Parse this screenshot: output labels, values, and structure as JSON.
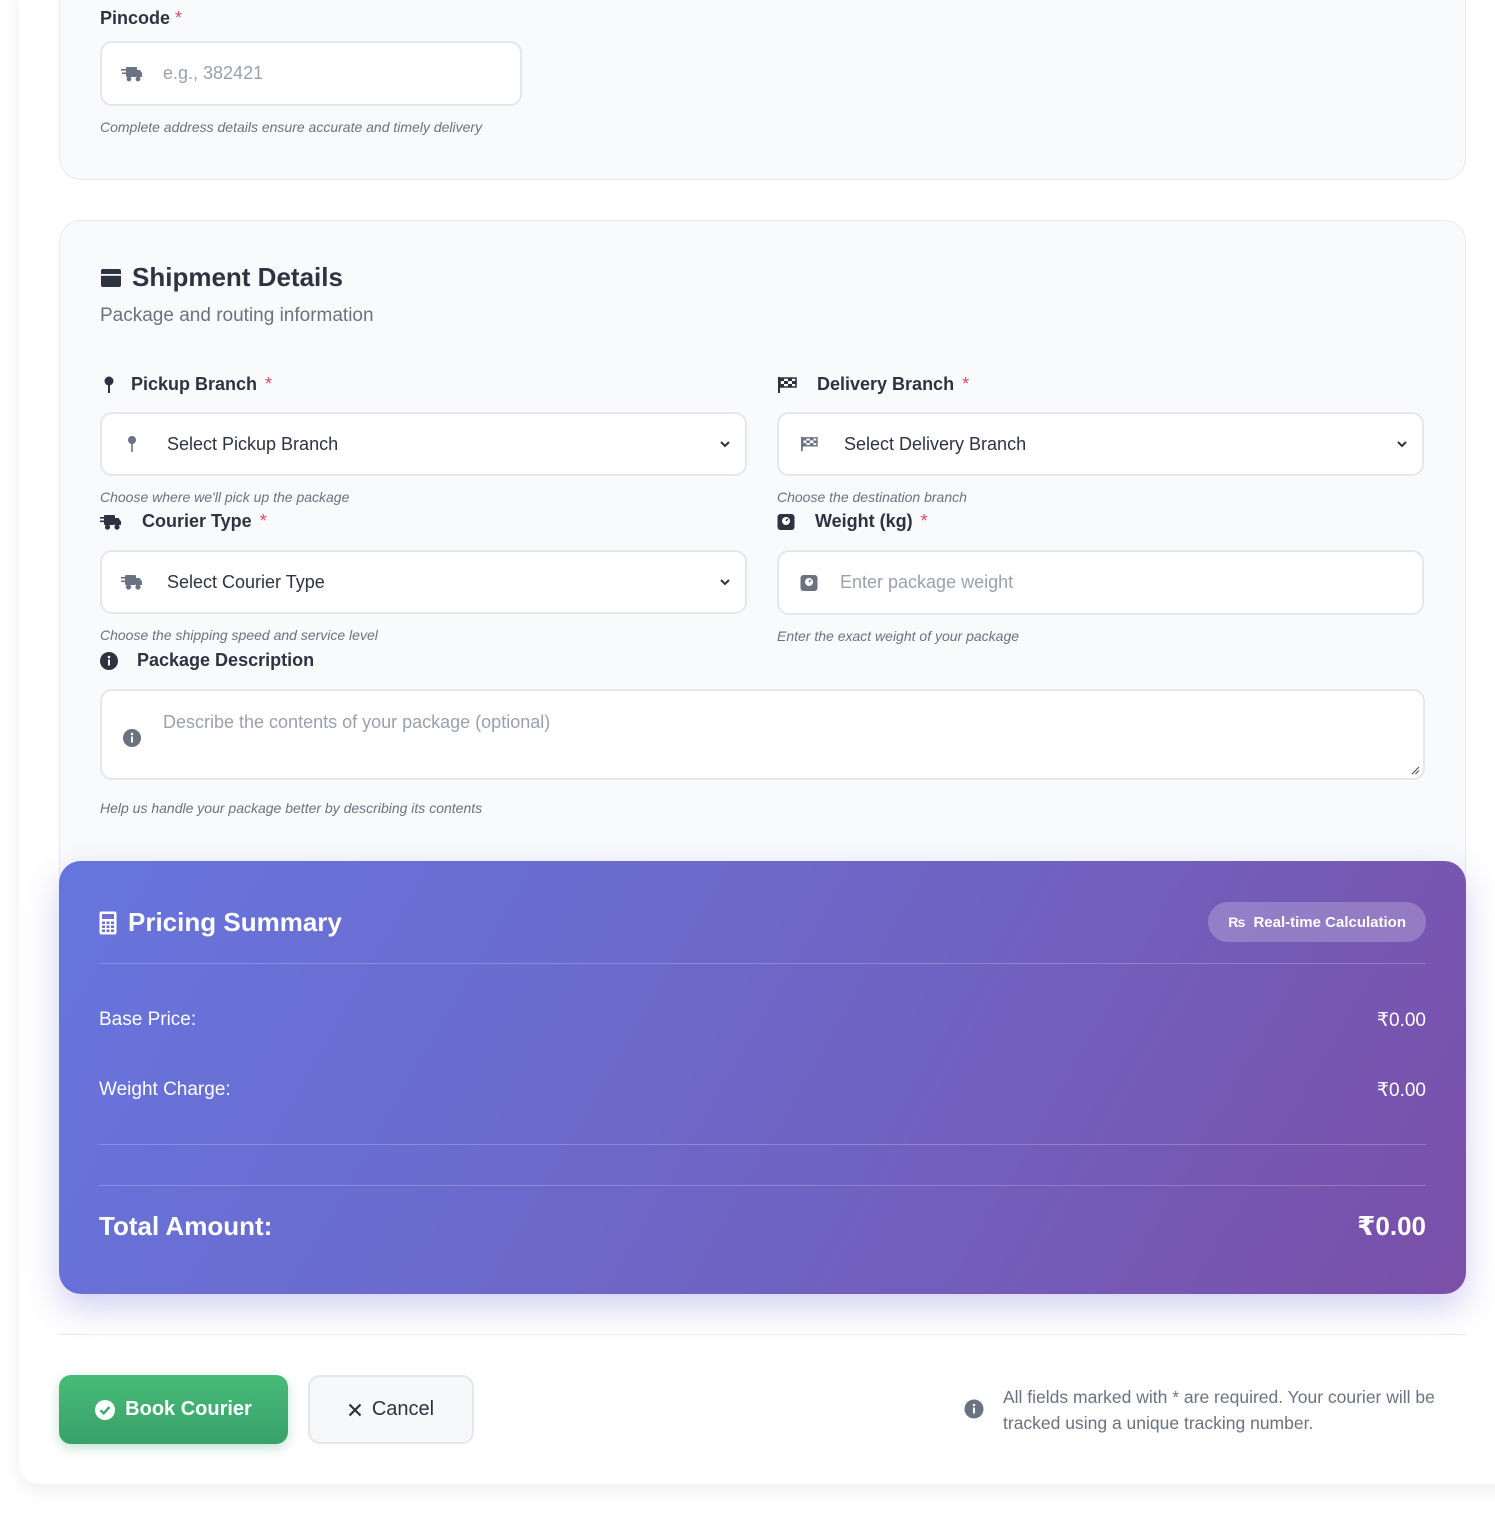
{
  "address_section": {
    "pincode_label": "Pincode",
    "required_mark": "*",
    "pincode_placeholder": "e.g., 382421",
    "hint": "Complete address details ensure accurate and timely delivery"
  },
  "shipment": {
    "title": "Shipment Details",
    "subtitle": "Package and routing information",
    "pickup": {
      "label": "Pickup Branch",
      "required": "*",
      "value": "Select Pickup Branch",
      "hint": "Choose where we'll pick up the package"
    },
    "delivery": {
      "label": "Delivery Branch",
      "required": "*",
      "value": "Select Delivery Branch",
      "hint": "Choose the destination branch"
    },
    "courier_type": {
      "label": "Courier Type",
      "required": "*",
      "value": "Select Courier Type",
      "hint": "Choose the shipping speed and service level"
    },
    "weight": {
      "label": "Weight (kg)",
      "required": "*",
      "placeholder": "Enter package weight",
      "hint": "Enter the exact weight of your package"
    },
    "description": {
      "label": "Package Description",
      "placeholder": "Describe the contents of your package (optional)",
      "hint": "Help us handle your package better by describing its contents"
    }
  },
  "pricing": {
    "title": "Pricing Summary",
    "badge": "Real-time Calculation",
    "base_price_label": "Base Price:",
    "base_price_value": "₹0.00",
    "weight_charge_label": "Weight Charge:",
    "weight_charge_value": "₹0.00",
    "total_label": "Total Amount:",
    "total_value": "₹0.00"
  },
  "actions": {
    "book_label": "Book Courier",
    "cancel_label": "Cancel",
    "note": "All fields marked with * are required. Your courier will be tracked using a unique tracking number."
  },
  "colors": {
    "accent_green": "#38a169",
    "pricing_gradient_start": "#6675de",
    "pricing_gradient_end": "#7a4fa8",
    "required_red": "#e04a5f"
  },
  "icons": {
    "pincode": "shipping-fast-icon",
    "section": "box-icon",
    "pickup": "map-pin-icon",
    "delivery": "checkered-flag-icon",
    "courier_type": "truck-icon",
    "weight": "weight-scale-icon",
    "description": "info-circle-icon",
    "pricing": "calculator-icon",
    "badge": "rupee-sign-icon",
    "book": "check-circle-icon",
    "cancel": "x-icon",
    "note": "info-circle-icon"
  }
}
